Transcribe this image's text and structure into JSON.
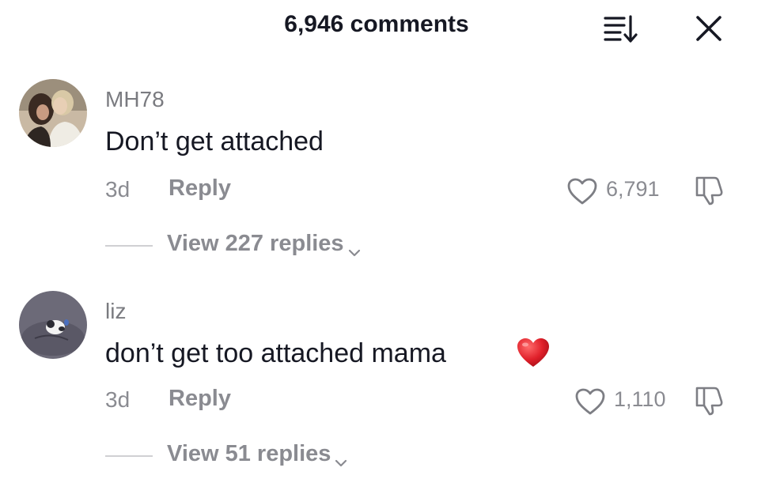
{
  "header": {
    "title": "6,946 comments"
  },
  "icons": {
    "sort": "sort-descending-icon",
    "close": "close-icon",
    "like": "heart-outline-icon",
    "dislike": "thumbs-down-icon",
    "chevron": "chevron-down-icon",
    "emoji": "red-heart-emoji"
  },
  "colors": {
    "text_primary": "#161823",
    "text_secondary": "#8a8b91",
    "heart_emoji": "#e0202a"
  },
  "comments": [
    {
      "username": "MH78",
      "text": "Don’t get attached",
      "time": "3d",
      "reply_label": "Reply",
      "likes": "6,791",
      "view_replies": "View 227 replies"
    },
    {
      "username": "liz",
      "text": "don’t get too attached mama",
      "time": "3d",
      "reply_label": "Reply",
      "likes": "1,110",
      "view_replies": "View 51 replies"
    }
  ]
}
